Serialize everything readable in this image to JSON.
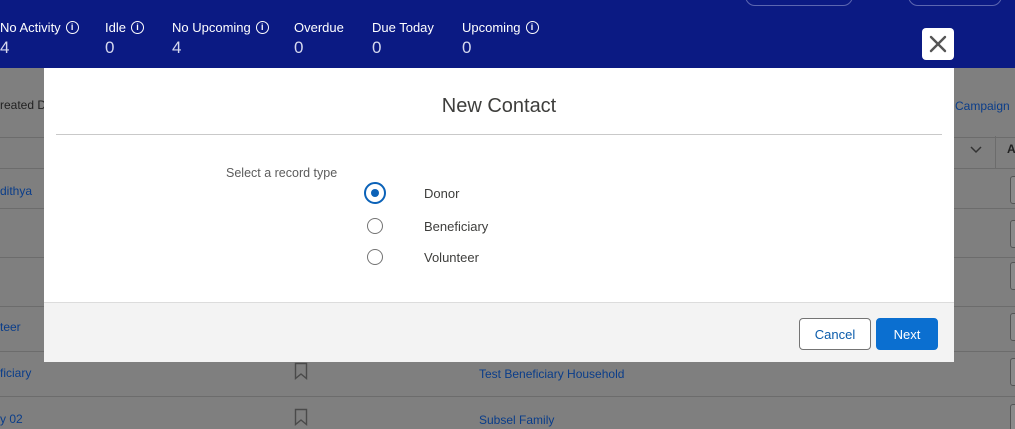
{
  "stats": [
    {
      "label": "No Activity",
      "value": "4",
      "info": true
    },
    {
      "label": "Idle",
      "value": "0",
      "info": true
    },
    {
      "label": "No Upcoming",
      "value": "4",
      "info": true
    },
    {
      "label": "Overdue",
      "value": "0",
      "info": false
    },
    {
      "label": "Due Today",
      "value": "0",
      "info": false
    },
    {
      "label": "Upcoming",
      "value": "0",
      "info": true
    }
  ],
  "background": {
    "created_col_fragment": "reated D",
    "campaign_fragment": "Campaign",
    "col_a_fragment": "A",
    "rows": [
      {
        "name_fragment": "dithya",
        "household": ""
      },
      {
        "name_fragment": "teer",
        "household": ""
      },
      {
        "name_fragment": "ficiary",
        "household": "Test Beneficiary Household"
      },
      {
        "name_fragment": "y 02",
        "household": "Subsel Family"
      }
    ]
  },
  "modal": {
    "title": "New Contact",
    "record_type_label": "Select a record type",
    "options": [
      {
        "label": "Donor",
        "selected": true
      },
      {
        "label": "Beneficiary",
        "selected": false
      },
      {
        "label": "Volunteer",
        "selected": false
      }
    ],
    "cancel_label": "Cancel",
    "next_label": "Next"
  },
  "colors": {
    "header_bg": "#0b1a83",
    "accent": "#0b62b8",
    "primary_button": "#0b6fd0"
  },
  "icons": {
    "close": "close-icon",
    "info": "info-icon",
    "bookmark": "bookmark-icon",
    "chevron": "chevron-down-icon"
  }
}
